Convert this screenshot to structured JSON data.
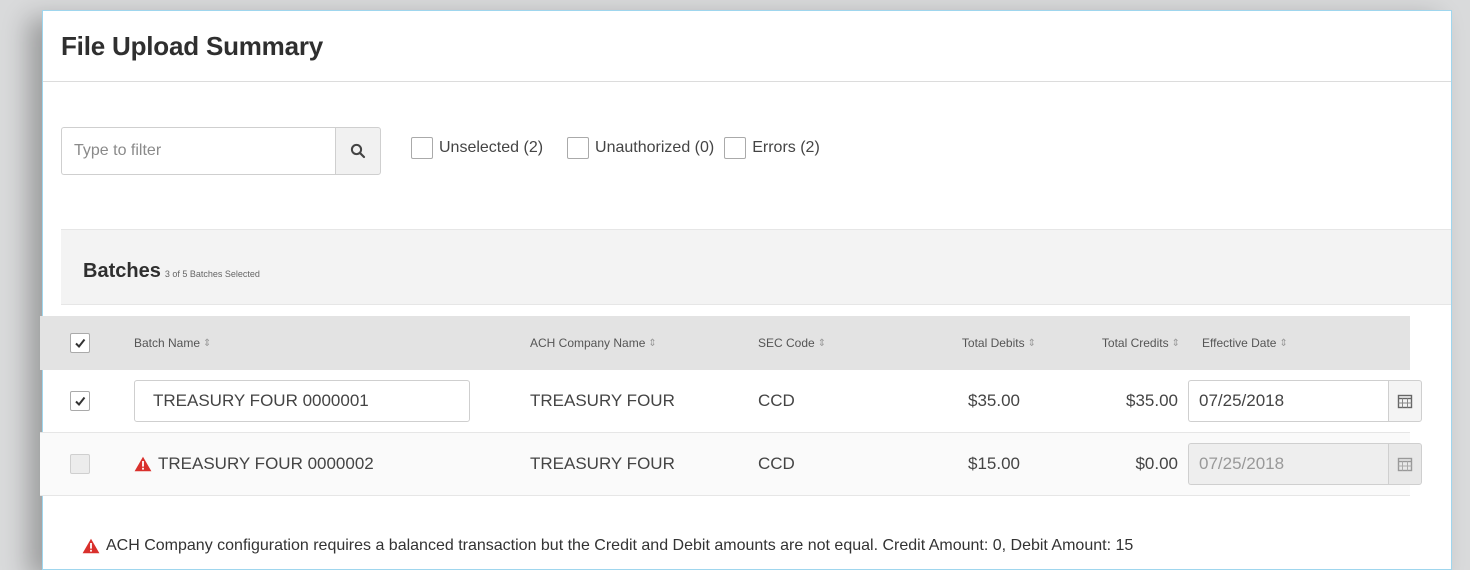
{
  "panel": {
    "title": "File Upload Summary"
  },
  "filter": {
    "placeholder": "Type to filter",
    "options": [
      {
        "label": "Unselected (2)",
        "checked": false
      },
      {
        "label": "Unauthorized (0)",
        "checked": false
      },
      {
        "label": "Errors (2)",
        "checked": false
      }
    ]
  },
  "batches": {
    "title": "Batches",
    "subtitle": "3 of 5 Batches Selected",
    "columns": {
      "batch_name": "Batch Name",
      "ach_company_name": "ACH Company Name",
      "sec_code": "SEC Code",
      "total_debits": "Total Debits",
      "total_credits": "Total Credits",
      "effective_date": "Effective Date",
      "sort_glyph": "⇕"
    },
    "header_checked": true,
    "rows": [
      {
        "checked": true,
        "batch_name": "TREASURY FOUR 0000001",
        "ach_company_name": "TREASURY FOUR",
        "sec_code": "CCD",
        "total_debits": "$35.00",
        "total_credits": "$35.00",
        "effective_date": "07/25/2018",
        "error": false
      },
      {
        "checked": false,
        "batch_name": "TREASURY FOUR 0000002",
        "ach_company_name": "TREASURY FOUR",
        "sec_code": "CCD",
        "total_debits": "$15.00",
        "total_credits": "$0.00",
        "effective_date": "07/25/2018",
        "error": true
      }
    ],
    "error_message": "ACH Company configuration requires a balanced transaction but the Credit and Debit amounts are not equal. Credit Amount: 0, Debit Amount: 15"
  },
  "colors": {
    "warning": "#d9302c",
    "panel_border": "#9fd6ee"
  },
  "icons": {
    "search": "search-icon",
    "calendar": "calendar-icon",
    "warning": "warning-icon",
    "check": "check-icon"
  }
}
